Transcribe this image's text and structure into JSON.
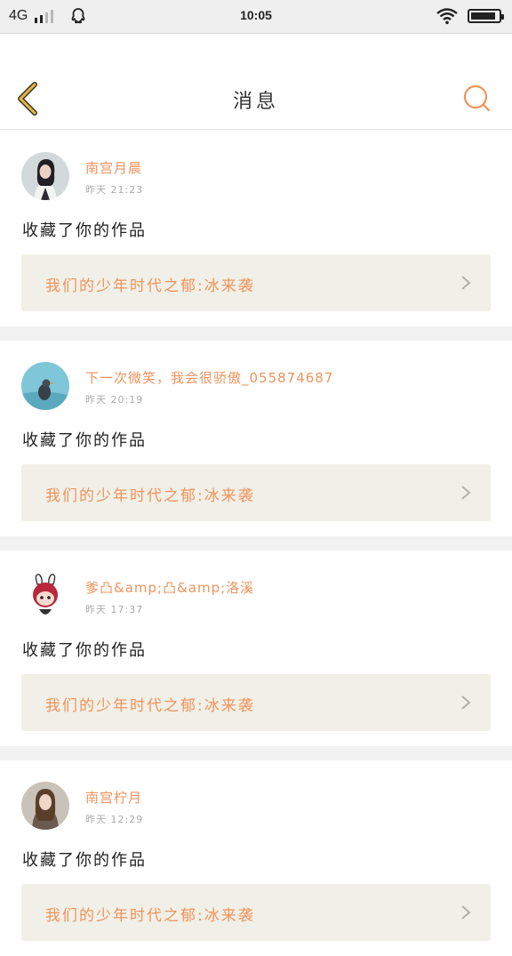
{
  "status_bar": {
    "network": "4G",
    "time": "10:05",
    "battery_level": 0.9
  },
  "header": {
    "title": "消息"
  },
  "messages": [
    {
      "name": "南宫月晨",
      "time": "昨天 21:23",
      "text": "收藏了你的作品",
      "work_title": "我们的少年时代之郁:冰来袭"
    },
    {
      "name": "下一次微笑，我会很骄傲_055874687",
      "time": "昨天 20:19",
      "text": "收藏了你的作品",
      "work_title": "我们的少年时代之郁:冰来袭"
    },
    {
      "name": "爹凸&amp;凸&amp;洛溪",
      "time": "昨天 17:37",
      "text": "收藏了你的作品",
      "work_title": "我们的少年时代之郁:冰来袭"
    },
    {
      "name": "南宫柠月",
      "time": "昨天 12:29",
      "text": "收藏了你的作品",
      "work_title": "我们的少年时代之郁:冰来袭"
    }
  ],
  "colors": {
    "accent": "#f0935a",
    "back_arrow": "#e8b540",
    "link_bg": "#f0f0e8"
  },
  "icons": {
    "back": "chevron-left-icon",
    "search": "search-icon",
    "link": "chevron-right-icon"
  }
}
